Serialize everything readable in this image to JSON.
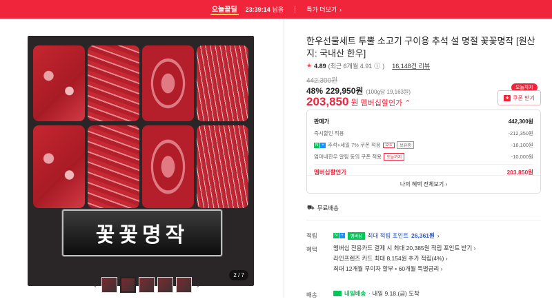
{
  "topbar": {
    "brand": "오늘끝딜",
    "timer": "23:39:14",
    "timer_suffix": "남음",
    "more_label": "특가 더보기",
    "bg_color": "#f0243b"
  },
  "gallery": {
    "plaque_text": "꽃꽃명작",
    "counter": "2 / 7",
    "prev_icon": "‹",
    "next_icon": "›"
  },
  "product": {
    "title": "한우선물세트 투뿔 소고기 구이용 추석 설 명절 꽃꽃명작 [원산지: 국내산 한우]",
    "rating": "4.89",
    "rating_detail": "(최근 6개월 4.91",
    "rating_detail_close": ")",
    "reviews": "16,148건 리뷰",
    "original_price": "442,300원",
    "discount_rate": "48%",
    "discount_price": "229,950원",
    "unit_price": "(100g당 19,163원)",
    "member_price": "203,850",
    "member_won": "원",
    "member_label": "멤버십할인가",
    "today_badge": "오늘까지",
    "coupon_button": "쿠폰 받기"
  },
  "breakdown": {
    "rows": [
      {
        "label": "판매가",
        "value": "442,300원"
      },
      {
        "label": "즉시할인 적용",
        "value": "-212,350원"
      },
      {
        "label": "추석+세일 7% 쿠폰 적용",
        "tag": "D-1",
        "tag2": "보유중",
        "value": "-16,100원"
      },
      {
        "label": "엄마네한우 알림 동의 쿠폰 적용",
        "tag": "오늘까지",
        "value": "-10,000원"
      }
    ],
    "total_label": "멤버십할인가",
    "total_value": "203,850원",
    "footer": "나의 혜택 전체보기"
  },
  "shipping": {
    "label": "무료배송"
  },
  "points": {
    "section": "적립",
    "np_badge": "멤버십",
    "text": "최대 적립 포인트",
    "value": "26,361원"
  },
  "benefits": {
    "section": "혜택",
    "lines": [
      "멤버십 전용카드 결제 시 최대 20,385원 적립 포인트 받기",
      "라인프렌즈 카드 최대 8,154원 추가 적립(4%)",
      "최대 12개월 무이자 할부 • 60개월 특별금리"
    ]
  },
  "delivery": {
    "section": "배송",
    "tomorrow": "내일배송",
    "date": "· 내일 9.18.(금) 도착"
  }
}
